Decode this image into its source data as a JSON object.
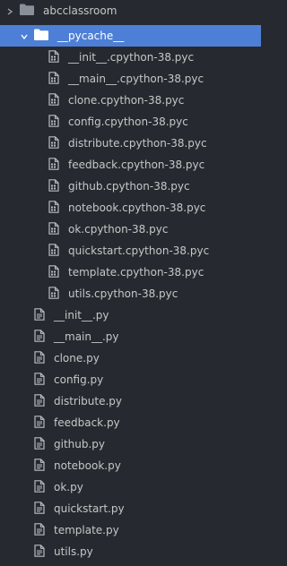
{
  "tree": {
    "root": {
      "label": "abcclassroom",
      "icon": "folder-icon",
      "state": "collapsed-view"
    },
    "pycache": {
      "label": "__pycache__",
      "icon": "folder-open-icon",
      "expanded": true,
      "selected": true,
      "items": [
        "__init__.cpython-38.pyc",
        "__main__.cpython-38.pyc",
        "clone.cpython-38.pyc",
        "config.cpython-38.pyc",
        "distribute.cpython-38.pyc",
        "feedback.cpython-38.pyc",
        "github.cpython-38.pyc",
        "notebook.cpython-38.pyc",
        "ok.cpython-38.pyc",
        "quickstart.cpython-38.pyc",
        "template.cpython-38.pyc",
        "utils.cpython-38.pyc"
      ]
    },
    "files": [
      "__init__.py",
      "__main__.py",
      "clone.py",
      "config.py",
      "distribute.py",
      "feedback.py",
      "github.py",
      "notebook.py",
      "ok.py",
      "quickstart.py",
      "template.py",
      "utils.py"
    ]
  },
  "colors": {
    "background": "#262a30",
    "selection": "#4d7fd6",
    "text": "#c5c8c6",
    "icon": "#b8bcc0"
  }
}
